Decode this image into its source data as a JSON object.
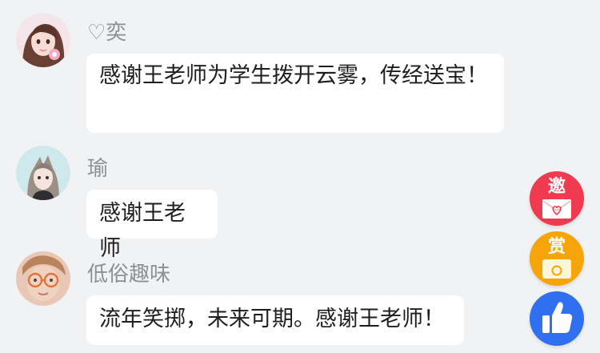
{
  "comments": [
    {
      "avatar_icon": "avatar-girl-icon",
      "name": "♡奕",
      "text": "感谢王老师为学生拨开云雾，传经送宝！"
    },
    {
      "avatar_icon": "avatar-anime-icon",
      "name": "瑜",
      "text": "感谢王老师"
    },
    {
      "avatar_icon": "avatar-glasses-icon",
      "name": "低俗趣味",
      "text": "流年笑掷，未来可期。感谢王老师！"
    }
  ],
  "side_buttons": {
    "invite": {
      "label": "邀",
      "icon": "heart-envelope-icon",
      "color": "#f03a4f"
    },
    "reward": {
      "label": "赏",
      "icon": "coin-icon",
      "color": "#f5a50a"
    },
    "like": {
      "icon": "thumbs-up-icon",
      "color": "#2f6ff0"
    }
  }
}
